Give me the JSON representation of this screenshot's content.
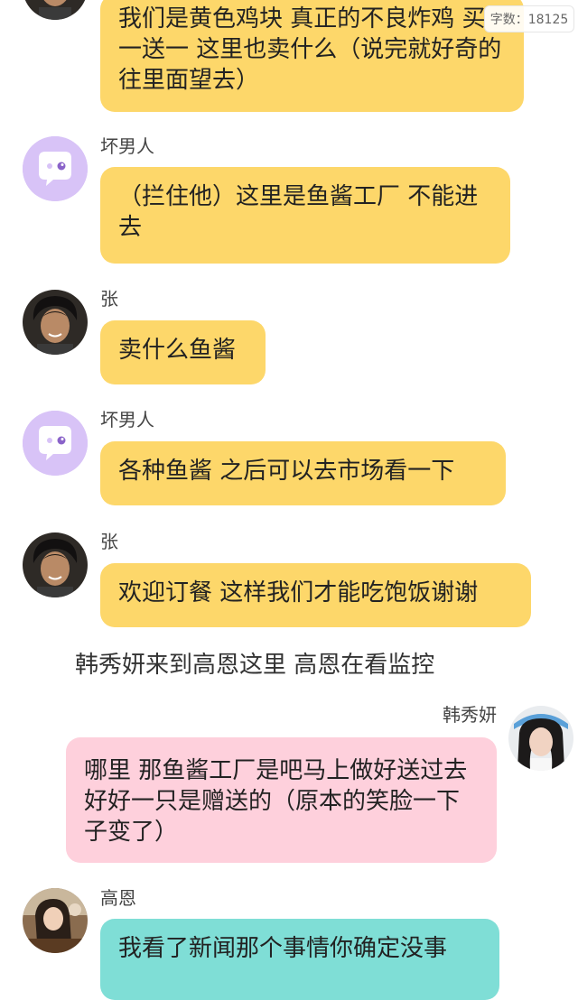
{
  "word_count": "字数：18125",
  "messages": [
    {
      "text": "我们是黄色鸡块 真正的不良炸鸡 买一送一 这里也卖什么（说完就好奇的往里面望去）"
    },
    {
      "name": "坏男人",
      "text": "（拦住他）这里是鱼酱工厂 不能进去"
    },
    {
      "name": "张",
      "text": "卖什么鱼酱"
    },
    {
      "name": "坏男人",
      "text": "各种鱼酱 之后可以去市场看一下"
    },
    {
      "name": "张",
      "text": "欢迎订餐 这样我们才能吃饱饭谢谢"
    },
    {
      "narration": "韩秀妍来到高恩这里 高恩在看监控"
    },
    {
      "name": "韩秀妍",
      "text": "哪里 那鱼酱工厂是吧马上做好送过去 好好一只是赠送的（原本的笑脸一下子变了）"
    },
    {
      "name": "高恩",
      "text": "我看了新闻那个事情你确定没事"
    }
  ],
  "colors": {
    "bubble_yellow": "#fdd76a",
    "bubble_pink": "#fed0dc",
    "bubble_teal": "#7fded6",
    "bot_avatar_bg": "#d8c3f7"
  },
  "icons": {
    "bot_avatar": "chat-bubble-face-icon"
  }
}
